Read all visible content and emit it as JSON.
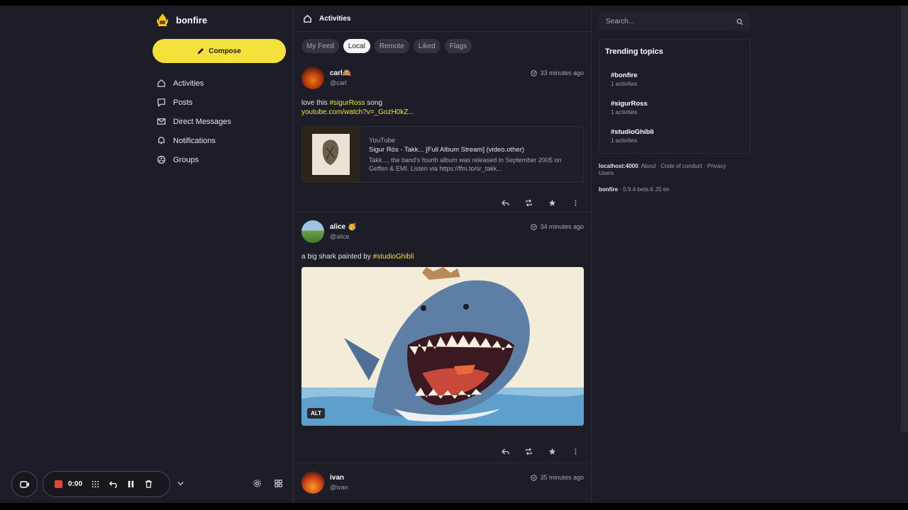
{
  "brand": {
    "name": "bonfire"
  },
  "compose": {
    "label": "Compose"
  },
  "nav": [
    {
      "label": "Activities",
      "icon": "home-icon"
    },
    {
      "label": "Posts",
      "icon": "post-icon"
    },
    {
      "label": "Direct Messages",
      "icon": "mail-icon"
    },
    {
      "label": "Notifications",
      "icon": "bell-icon"
    },
    {
      "label": "Groups",
      "icon": "groups-icon"
    }
  ],
  "header": {
    "title": "Activities"
  },
  "tabs": [
    {
      "label": "My Feed",
      "active": false
    },
    {
      "label": "Local",
      "active": true
    },
    {
      "label": "Remote",
      "active": false
    },
    {
      "label": "Liked",
      "active": false
    },
    {
      "label": "Flags",
      "active": false
    }
  ],
  "posts": [
    {
      "name": "carl🙈",
      "handle": "@carl",
      "time": "33 minutes ago",
      "text_before": "love this ",
      "tag": "#sigurRoss",
      "text_after": " song",
      "link": "youtube.com/watch?v=_GozH0kZ...",
      "embed": {
        "source": "YouTube",
        "title": "Sigur Rós - Takk... [Full Album Stream] (video.other)",
        "description": "Takk..., the band's fourth album was released in September 2005 on Geffen & EMI. Listen via https://ffm.to/sr_takk..."
      }
    },
    {
      "name": "alice 🥳",
      "handle": "@alice",
      "time": "34 minutes ago",
      "text_before": "a big shark painted by ",
      "tag": "#studioGhibli",
      "image_alt_label": "ALT"
    },
    {
      "name": "ivan",
      "handle": "@ivan",
      "time": "35 minutes ago"
    }
  ],
  "search": {
    "placeholder": "Search..."
  },
  "trending": {
    "title": "Trending topics",
    "items": [
      {
        "tag": "#bonfire",
        "count": "1 activities"
      },
      {
        "tag": "#sigurRoss",
        "count": "1 activities"
      },
      {
        "tag": "#studioGhibli",
        "count": "1 activities"
      }
    ]
  },
  "footer": {
    "host": "localhost:4000",
    "links": ": About · Code of conduct · Privacy",
    "users": "Users",
    "app": "bonfire",
    "version": " · 0.9.4-beta.6  JS  en"
  },
  "recorder": {
    "time": "0:00"
  },
  "colors": {
    "accent": "#f5e13b",
    "background": "#1d1d27",
    "record": "#e5453a"
  }
}
